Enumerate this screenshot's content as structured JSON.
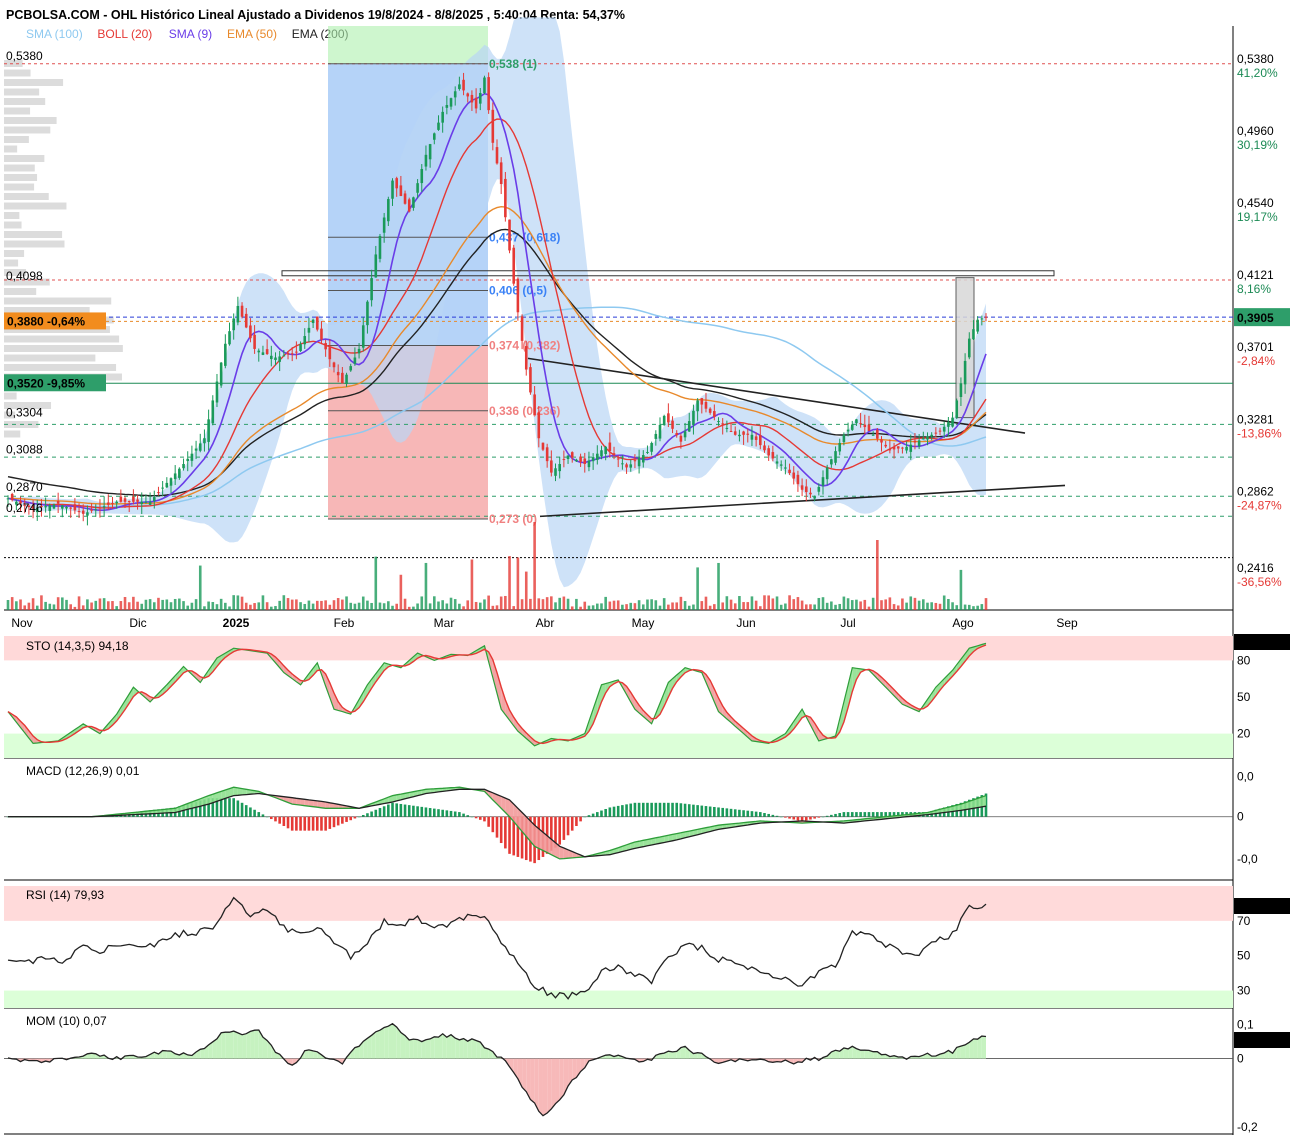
{
  "header": {
    "title": "PCBOLSA.COM - OHL Histórico Lineal Ajustado a Dividenos 19/8/2024 - 8/8/2025 , 5:40:04 Renta: 54,37%"
  },
  "legend": [
    {
      "label": "SMA (100)",
      "color": "#8ec9f0"
    },
    {
      "label": "BOLL (20)",
      "color": "#e53935"
    },
    {
      "label": "SMA (9)",
      "color": "#6a3de8"
    },
    {
      "label": "EMA (50)",
      "color": "#e8892b"
    },
    {
      "label": "EMA (200)",
      "color": "#222222"
    }
  ],
  "colors": {
    "up": "#1a9a5a",
    "down": "#e53935",
    "boll_fill": "#b9d6f5",
    "sma9": "#6a3de8",
    "boll_mid": "#e53935",
    "ema50": "#e8892b",
    "ema200": "#222222",
    "sma100": "#8ec9f0",
    "fib_blue": "#3b82f6",
    "fib_red": "#f08080"
  },
  "chart_data": [
    {
      "type": "line",
      "name": "price",
      "ylim": [
        0.22,
        0.56
      ],
      "months": [
        "Nov",
        "Dic",
        "2025",
        "Feb",
        "Mar",
        "Abr",
        "May",
        "Jun",
        "Jul",
        "Ago",
        "Sep"
      ],
      "right_axis": [
        {
          "value": "0,5380",
          "pct": "41,20%",
          "pct_color": "green"
        },
        {
          "value": "0,4960",
          "pct": "30,19%",
          "pct_color": "green"
        },
        {
          "value": "0,4540",
          "pct": "19,17%",
          "pct_color": "green"
        },
        {
          "value": "0,4121",
          "pct": "8,16%",
          "pct_color": "green"
        },
        {
          "value": "0,3701",
          "pct": "-2,84%",
          "pct_color": "red"
        },
        {
          "value": "0,3281",
          "pct": "-13,86%",
          "pct_color": "red"
        },
        {
          "value": "0,2862",
          "pct": "-24,87%",
          "pct_color": "red"
        },
        {
          "value": "0,2416",
          "pct": "-36,56%",
          "pct_color": "red"
        }
      ],
      "left_levels": [
        "0,5380",
        "0,4098",
        "0,3304",
        "0,3088",
        "0,2870",
        "0,2746"
      ],
      "last_price": "0,3905",
      "badges": [
        {
          "label": "0,3880 -0,64%",
          "color": "#f28c1e"
        },
        {
          "label": "0,3520 -9,85%",
          "color": "#2e9e6a"
        }
      ],
      "fib_levels": [
        {
          "label": "0,538 (1)",
          "value": 0.538
        },
        {
          "label": "0,437 (0,618)",
          "value": 0.437
        },
        {
          "label": "0,406 (0,5)",
          "value": 0.406
        },
        {
          "label": "0,374 (0,382)",
          "value": 0.374
        },
        {
          "label": "0,336 (0,236)",
          "value": 0.336
        },
        {
          "label": "0,273 (0)",
          "value": 0.273
        }
      ],
      "close_anchors": [
        [
          0,
          0.285
        ],
        [
          6,
          0.279
        ],
        [
          12,
          0.282
        ],
        [
          18,
          0.276
        ],
        [
          26,
          0.283
        ],
        [
          34,
          0.283
        ],
        [
          42,
          0.305
        ],
        [
          47,
          0.32
        ],
        [
          52,
          0.375
        ],
        [
          55,
          0.397
        ],
        [
          59,
          0.372
        ],
        [
          64,
          0.367
        ],
        [
          69,
          0.37
        ],
        [
          73,
          0.389
        ],
        [
          77,
          0.366
        ],
        [
          80,
          0.352
        ],
        [
          84,
          0.372
        ],
        [
          88,
          0.427
        ],
        [
          92,
          0.47
        ],
        [
          96,
          0.452
        ],
        [
          100,
          0.485
        ],
        [
          104,
          0.51
        ],
        [
          108,
          0.526
        ],
        [
          112,
          0.512
        ],
        [
          114,
          0.53
        ],
        [
          116,
          0.492
        ],
        [
          118,
          0.468
        ],
        [
          121,
          0.41
        ],
        [
          124,
          0.36
        ],
        [
          127,
          0.32
        ],
        [
          130,
          0.3
        ],
        [
          134,
          0.31
        ],
        [
          138,
          0.305
        ],
        [
          143,
          0.315
        ],
        [
          148,
          0.303
        ],
        [
          153,
          0.312
        ],
        [
          157,
          0.333
        ],
        [
          161,
          0.318
        ],
        [
          165,
          0.342
        ],
        [
          170,
          0.33
        ],
        [
          174,
          0.322
        ],
        [
          178,
          0.322
        ],
        [
          182,
          0.31
        ],
        [
          186,
          0.303
        ],
        [
          190,
          0.29
        ],
        [
          193,
          0.286
        ],
        [
          196,
          0.303
        ],
        [
          200,
          0.322
        ],
        [
          203,
          0.331
        ],
        [
          207,
          0.322
        ],
        [
          211,
          0.313
        ],
        [
          215,
          0.315
        ],
        [
          219,
          0.32
        ],
        [
          223,
          0.324
        ],
        [
          226,
          0.332
        ],
        [
          228,
          0.352
        ],
        [
          230,
          0.378
        ],
        [
          232,
          0.389
        ],
        [
          234,
          0.3905
        ]
      ]
    },
    {
      "type": "line",
      "name": "STO (14,3,5)",
      "label": "STO (14,3,5)",
      "value": "94,18",
      "last": "94,187",
      "ylim": [
        0,
        100
      ],
      "axis": [
        "80",
        "50",
        "20"
      ],
      "k_anchors": [
        [
          0,
          38
        ],
        [
          6,
          12
        ],
        [
          12,
          14
        ],
        [
          18,
          28
        ],
        [
          22,
          20
        ],
        [
          26,
          36
        ],
        [
          30,
          58
        ],
        [
          34,
          46
        ],
        [
          38,
          60
        ],
        [
          42,
          75
        ],
        [
          46,
          62
        ],
        [
          50,
          82
        ],
        [
          54,
          90
        ],
        [
          58,
          88
        ],
        [
          62,
          86
        ],
        [
          66,
          70
        ],
        [
          70,
          60
        ],
        [
          74,
          78
        ],
        [
          78,
          40
        ],
        [
          82,
          36
        ],
        [
          86,
          60
        ],
        [
          90,
          78
        ],
        [
          94,
          74
        ],
        [
          98,
          86
        ],
        [
          102,
          80
        ],
        [
          106,
          85
        ],
        [
          110,
          84
        ],
        [
          114,
          92
        ],
        [
          118,
          40
        ],
        [
          122,
          22
        ],
        [
          126,
          10
        ],
        [
          130,
          16
        ],
        [
          134,
          14
        ],
        [
          138,
          20
        ],
        [
          142,
          60
        ],
        [
          146,
          64
        ],
        [
          150,
          40
        ],
        [
          154,
          28
        ],
        [
          158,
          62
        ],
        [
          162,
          74
        ],
        [
          166,
          70
        ],
        [
          170,
          38
        ],
        [
          174,
          26
        ],
        [
          178,
          14
        ],
        [
          182,
          12
        ],
        [
          186,
          20
        ],
        [
          190,
          40
        ],
        [
          194,
          14
        ],
        [
          198,
          18
        ],
        [
          202,
          74
        ],
        [
          206,
          72
        ],
        [
          210,
          58
        ],
        [
          214,
          44
        ],
        [
          218,
          38
        ],
        [
          222,
          58
        ],
        [
          226,
          72
        ],
        [
          230,
          90
        ],
        [
          234,
          94
        ]
      ]
    },
    {
      "type": "line",
      "name": "MACD (12,26,9)",
      "label": "MACD (12,26,9)",
      "value": "0,01",
      "axis": [
        "0,0",
        "0",
        "-0,0"
      ],
      "ylim": [
        -0.03,
        0.025
      ],
      "macd_anchors": [
        [
          0,
          0.0
        ],
        [
          20,
          0.0
        ],
        [
          30,
          0.002
        ],
        [
          40,
          0.004
        ],
        [
          48,
          0.01
        ],
        [
          54,
          0.014
        ],
        [
          60,
          0.012
        ],
        [
          68,
          0.006
        ],
        [
          76,
          0.004
        ],
        [
          84,
          0.004
        ],
        [
          92,
          0.01
        ],
        [
          100,
          0.013
        ],
        [
          108,
          0.014
        ],
        [
          114,
          0.012
        ],
        [
          120,
          0.0
        ],
        [
          126,
          -0.014
        ],
        [
          132,
          -0.02
        ],
        [
          138,
          -0.019
        ],
        [
          144,
          -0.016
        ],
        [
          150,
          -0.012
        ],
        [
          160,
          -0.008
        ],
        [
          170,
          -0.004
        ],
        [
          180,
          -0.002
        ],
        [
          190,
          -0.003
        ],
        [
          200,
          -0.002
        ],
        [
          210,
          0.0
        ],
        [
          220,
          0.002
        ],
        [
          228,
          0.006
        ],
        [
          234,
          0.01
        ]
      ],
      "signal_anchors": [
        [
          0,
          0.0
        ],
        [
          20,
          0.0
        ],
        [
          30,
          0.001
        ],
        [
          40,
          0.002
        ],
        [
          48,
          0.006
        ],
        [
          54,
          0.01
        ],
        [
          60,
          0.011
        ],
        [
          68,
          0.009
        ],
        [
          76,
          0.007
        ],
        [
          84,
          0.004
        ],
        [
          92,
          0.007
        ],
        [
          100,
          0.011
        ],
        [
          108,
          0.013
        ],
        [
          114,
          0.013
        ],
        [
          120,
          0.008
        ],
        [
          126,
          -0.004
        ],
        [
          132,
          -0.014
        ],
        [
          138,
          -0.019
        ],
        [
          144,
          -0.018
        ],
        [
          150,
          -0.015
        ],
        [
          160,
          -0.011
        ],
        [
          170,
          -0.006
        ],
        [
          180,
          -0.003
        ],
        [
          190,
          -0.002
        ],
        [
          200,
          -0.003
        ],
        [
          210,
          -0.001
        ],
        [
          220,
          0.001
        ],
        [
          228,
          0.003
        ],
        [
          234,
          0.005
        ]
      ]
    },
    {
      "type": "line",
      "name": "RSI (14)",
      "label": "RSI (14)",
      "value": "79,93",
      "last": "79,934",
      "ylim": [
        20,
        90
      ],
      "axis": [
        "70",
        "50",
        "30"
      ],
      "anchors": [
        [
          0,
          46
        ],
        [
          8,
          48
        ],
        [
          14,
          47
        ],
        [
          18,
          56
        ],
        [
          22,
          52
        ],
        [
          28,
          58
        ],
        [
          34,
          56
        ],
        [
          40,
          62
        ],
        [
          46,
          64
        ],
        [
          50,
          68
        ],
        [
          54,
          84
        ],
        [
          58,
          72
        ],
        [
          62,
          76
        ],
        [
          66,
          66
        ],
        [
          70,
          64
        ],
        [
          74,
          66
        ],
        [
          78,
          58
        ],
        [
          82,
          50
        ],
        [
          86,
          58
        ],
        [
          90,
          70
        ],
        [
          94,
          66
        ],
        [
          98,
          72
        ],
        [
          102,
          66
        ],
        [
          106,
          68
        ],
        [
          110,
          72
        ],
        [
          114,
          74
        ],
        [
          118,
          56
        ],
        [
          122,
          46
        ],
        [
          126,
          32
        ],
        [
          130,
          28
        ],
        [
          134,
          26
        ],
        [
          138,
          30
        ],
        [
          142,
          40
        ],
        [
          146,
          44
        ],
        [
          150,
          38
        ],
        [
          154,
          36
        ],
        [
          158,
          50
        ],
        [
          162,
          56
        ],
        [
          166,
          54
        ],
        [
          170,
          48
        ],
        [
          174,
          46
        ],
        [
          178,
          42
        ],
        [
          182,
          40
        ],
        [
          186,
          36
        ],
        [
          190,
          34
        ],
        [
          194,
          40
        ],
        [
          198,
          44
        ],
        [
          202,
          64
        ],
        [
          206,
          62
        ],
        [
          210,
          56
        ],
        [
          214,
          52
        ],
        [
          218,
          50
        ],
        [
          222,
          58
        ],
        [
          226,
          62
        ],
        [
          230,
          78
        ],
        [
          234,
          80
        ]
      ]
    },
    {
      "type": "area",
      "name": "MOM (10)",
      "label": "MOM (10)",
      "value": "0,07",
      "last": "0,074",
      "ylim": [
        -0.22,
        0.13
      ],
      "axis": [
        "0,1",
        "0",
        "-0,2"
      ],
      "anchors": [
        [
          0,
          0.0
        ],
        [
          8,
          -0.01
        ],
        [
          14,
          0.0
        ],
        [
          20,
          0.01
        ],
        [
          26,
          0.0
        ],
        [
          32,
          0.01
        ],
        [
          38,
          0.02
        ],
        [
          44,
          0.01
        ],
        [
          48,
          0.04
        ],
        [
          52,
          0.08
        ],
        [
          56,
          0.07
        ],
        [
          60,
          0.08
        ],
        [
          64,
          0.02
        ],
        [
          68,
          -0.02
        ],
        [
          72,
          0.03
        ],
        [
          76,
          0.0
        ],
        [
          80,
          -0.01
        ],
        [
          84,
          0.04
        ],
        [
          88,
          0.08
        ],
        [
          92,
          0.1
        ],
        [
          96,
          0.06
        ],
        [
          100,
          0.05
        ],
        [
          104,
          0.07
        ],
        [
          108,
          0.06
        ],
        [
          112,
          0.05
        ],
        [
          116,
          0.02
        ],
        [
          120,
          -0.02
        ],
        [
          124,
          -0.1
        ],
        [
          128,
          -0.17
        ],
        [
          132,
          -0.12
        ],
        [
          136,
          -0.05
        ],
        [
          140,
          0.0
        ],
        [
          146,
          0.01
        ],
        [
          152,
          -0.01
        ],
        [
          158,
          0.02
        ],
        [
          162,
          0.03
        ],
        [
          166,
          0.01
        ],
        [
          170,
          -0.01
        ],
        [
          176,
          0.0
        ],
        [
          182,
          -0.01
        ],
        [
          188,
          -0.01
        ],
        [
          194,
          0.0
        ],
        [
          198,
          0.02
        ],
        [
          202,
          0.03
        ],
        [
          208,
          0.02
        ],
        [
          214,
          0.0
        ],
        [
          220,
          0.01
        ],
        [
          226,
          0.02
        ],
        [
          230,
          0.05
        ],
        [
          234,
          0.07
        ]
      ]
    }
  ]
}
